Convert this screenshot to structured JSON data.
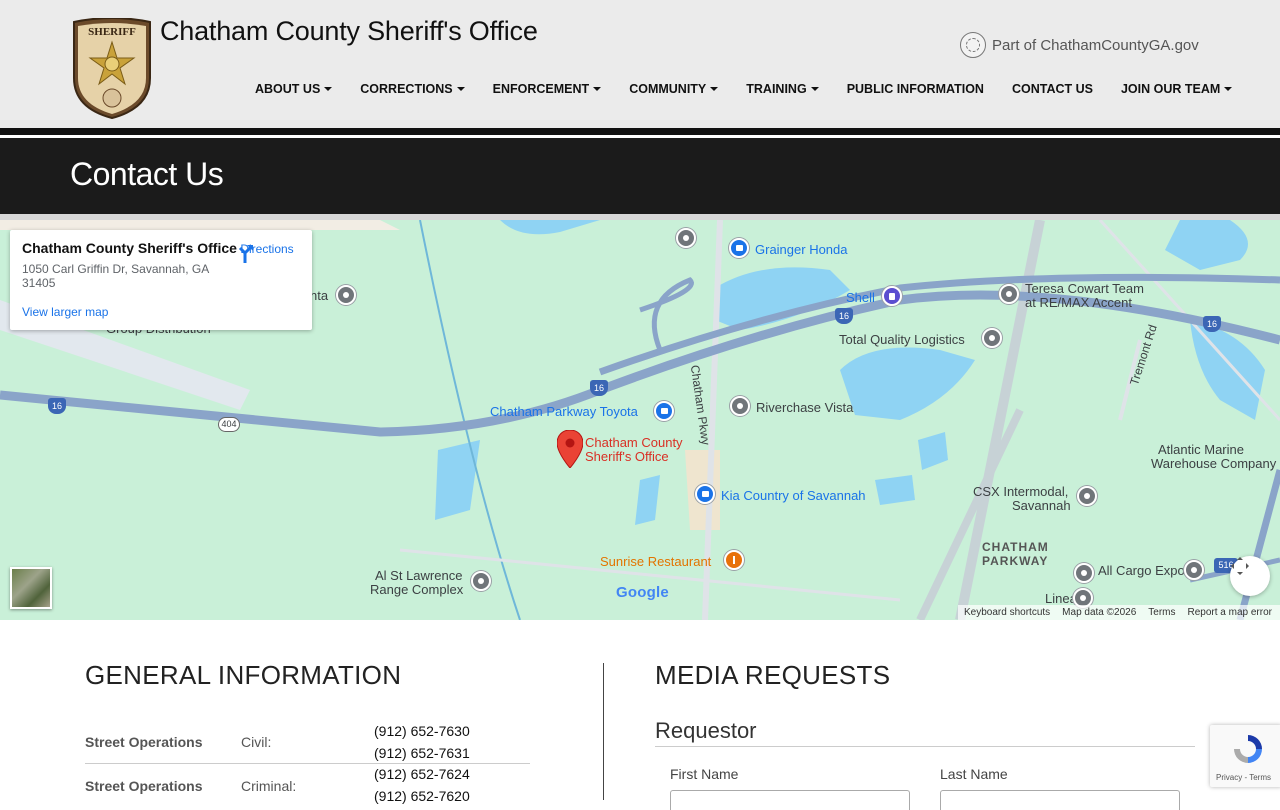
{
  "header": {
    "site_title": "Chatham County Sheriff's Office",
    "county_link": "Part of ChathamCountyGA.gov",
    "badge_top_text": "SHERIFF",
    "nav": [
      {
        "label": "ABOUT US",
        "dropdown": true
      },
      {
        "label": "CORRECTIONS",
        "dropdown": true
      },
      {
        "label": "ENFORCEMENT",
        "dropdown": true
      },
      {
        "label": "COMMUNITY",
        "dropdown": true
      },
      {
        "label": "TRAINING",
        "dropdown": true
      },
      {
        "label": "PUBLIC INFORMATION",
        "dropdown": false
      },
      {
        "label": "CONTACT US",
        "dropdown": false
      },
      {
        "label": "JOIN OUR TEAM",
        "dropdown": true
      }
    ]
  },
  "banner": {
    "title": "Contact Us"
  },
  "map": {
    "info_card": {
      "title": "Chatham County Sheriff's Office",
      "address": "1050 Carl Griffin Dr, Savannah, GA 31405",
      "view_larger": "View larger map",
      "directions": "Directions"
    },
    "labels": {
      "grainger": "Grainger Honda",
      "shell": "Shell",
      "teresa": "Teresa Cowart Team",
      "teresa2": "at RE/MAX Accent",
      "total_quality": "Total Quality Logistics",
      "tremont": "Tremont Rd",
      "chatham_pkwy": "Chatham Pkwy",
      "chatham_toyota": "Chatham Parkway Toyota",
      "riverchase": "Riverchase Vista",
      "atlantic": "Atlantic Marine",
      "atlantic2": "Warehouse Company",
      "sheriff": "Chatham County",
      "sheriff2": "Sheriff's Office",
      "kia": "Kia Country of Savannah",
      "csx": "CSX Intermodal,",
      "csx2": "Savannah",
      "chatham_parkway_area": "CHATHAM",
      "chatham_parkway_area2": "PARKWAY",
      "sunrise": "Sunrise Restaurant",
      "al_st": "Al St Lawrence",
      "al_st2": "Range Complex",
      "all_cargo": "All Cargo Export",
      "lineage": "Lineage",
      "group_dist": "Group Distribution",
      "partial_nta": "nta",
      "route_16": "16",
      "route_404": "404",
      "route_516": "516",
      "google": "Google"
    },
    "footer": {
      "shortcuts": "Keyboard shortcuts",
      "data": "Map data ©2026",
      "terms": "Terms",
      "report": "Report a map error"
    }
  },
  "general": {
    "title": "GENERAL INFORMATION",
    "rows": [
      {
        "label": "Street Operations",
        "type": "Civil:",
        "phones": [
          "(912) 652-7630",
          "(912) 652-7631"
        ]
      },
      {
        "label": "Street Operations",
        "type": "Criminal:",
        "phones": [
          "(912) 652-7624",
          "(912) 652-7620"
        ]
      }
    ]
  },
  "media": {
    "title": "MEDIA REQUESTS",
    "requestor": "Requestor",
    "first_name": "First Name",
    "last_name": "Last Name"
  },
  "recaptcha": {
    "privacy": "Privacy",
    "terms": "Terms"
  },
  "colors": {
    "map_bg": "#c9f0d8",
    "highway": "#8aa4c9",
    "water": "#8fd3f3",
    "link": "#1a73e8"
  }
}
